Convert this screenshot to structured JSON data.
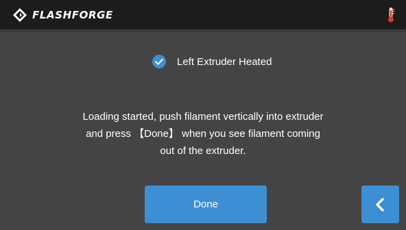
{
  "header": {
    "brand": "FLASHFORGE",
    "logo_icon": "flashforge-diamond-logo",
    "temperature_icon": "thermometer-icon"
  },
  "status": {
    "icon": "check-circle-icon",
    "label": "Left Extruder Heated"
  },
  "instruction": {
    "lines": [
      "Loading started, push filament vertically into extruder",
      "and press 【Done】 when you see filament coming",
      "out of the extruder."
    ]
  },
  "buttons": {
    "done_label": "Done",
    "back_icon": "chevron-left-icon"
  },
  "colors": {
    "background": "#444444",
    "header_bar": "#1c1c1c",
    "accent_blue": "#3e8ed4",
    "thermometer_red": "#d83a2e"
  }
}
